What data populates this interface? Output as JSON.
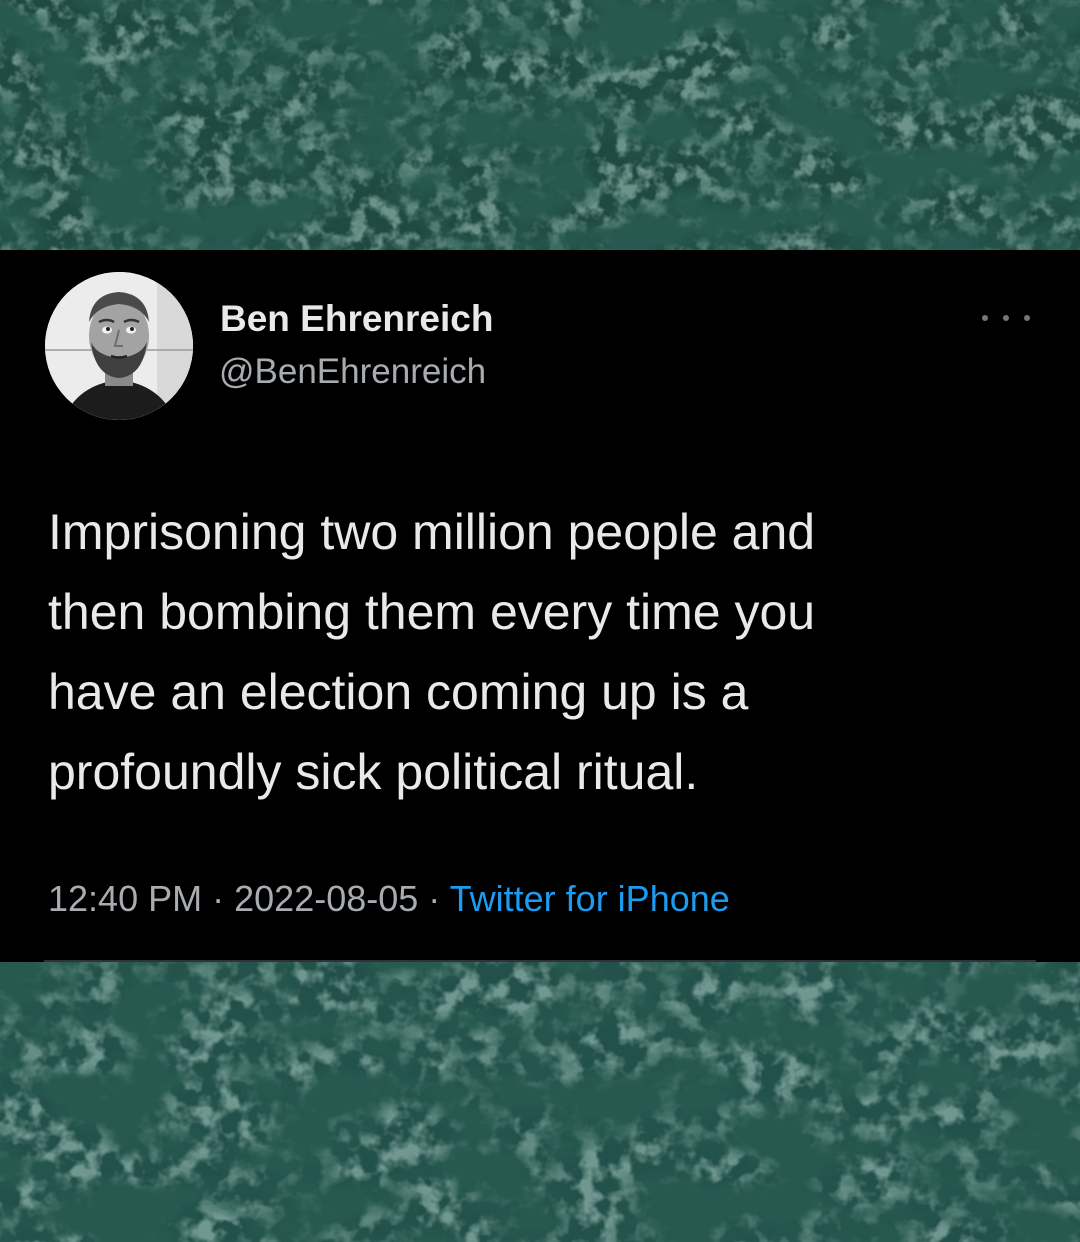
{
  "tweet": {
    "author": {
      "display_name": "Ben Ehrenreich",
      "handle": "@BenEhrenreich"
    },
    "more_icon": "more-horizontal-icon",
    "text_lines": [
      "Imprisoning two million people and",
      "then bombing them every time you",
      "have an election coming up is a",
      "profoundly sick political ritual."
    ],
    "time": "12:40 PM",
    "separator": "·",
    "date": "2022-08-05",
    "source": "Twitter for iPhone"
  },
  "colors": {
    "card_background": "#000000",
    "primary_text": "#e7e9ea",
    "secondary_text": "#a8acb0",
    "link": "#1d9bf0",
    "backdrop": "#0e2a25"
  }
}
